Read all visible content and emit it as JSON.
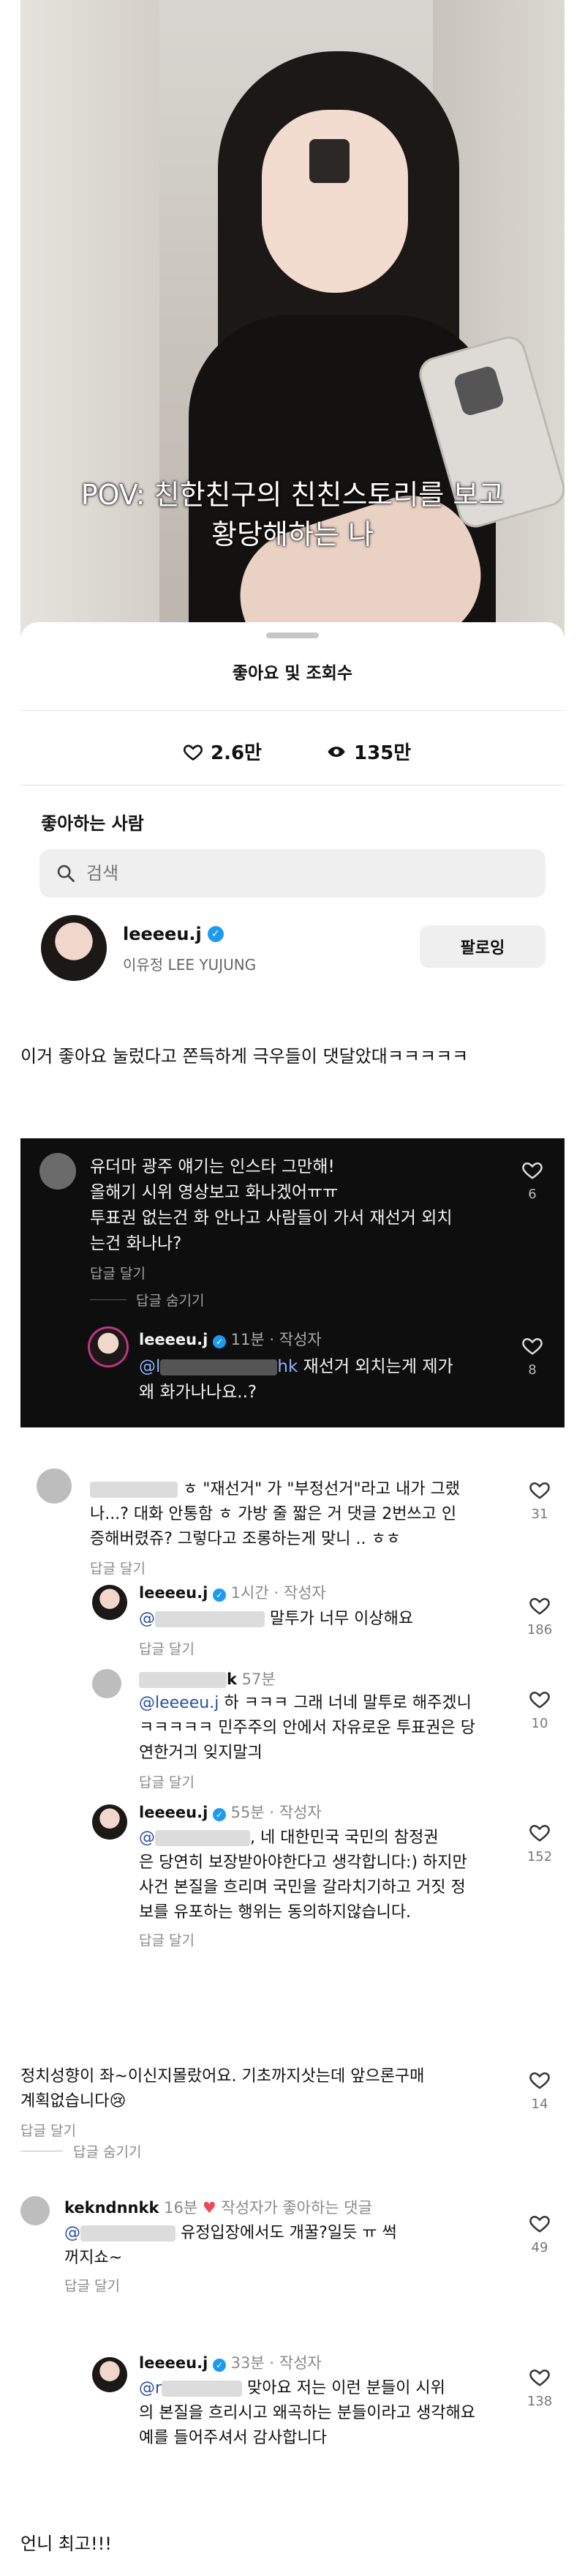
{
  "video": {
    "caption_line1": "POV: 친한친구의 친친스토리를 보고",
    "caption_line2": "황당해하는 나"
  },
  "likes_sheet": {
    "title": "좋아요 및 조회수",
    "likes_count": "2.6만",
    "views_count": "135만",
    "likers_title": "좋아하는 사람",
    "search_placeholder": "검색",
    "liker": {
      "username": "leeeeu.j",
      "real_name": "이유정 LEE YUJUNG",
      "follow_label": "팔로잉"
    }
  },
  "post_caption": "이거 좋아요 눌렀다고 쫀득하게 극우들이 댓달았대ㅋㅋㅋㅋㅋ",
  "dark_thread": {
    "comment": {
      "lines": [
        "유더마 광주 얘기는 인스타 그만해!",
        "올해기 시위 영상보고 화나겠어ㅠㅠ",
        "투표권 없는건 화 안나고 사람들이 가서 재선거 외치",
        "는건 화나나?"
      ],
      "reply_label": "답글 달기",
      "like_count": "6",
      "hide_replies": "답글 숨기기"
    },
    "reply": {
      "username": "leeeeu.j",
      "time": "11분",
      "author_tag": "작성자",
      "mention": "@l",
      "mention_tail": "hk",
      "line1_rest": "재선거 외치는게 제가",
      "line2": "왜 화가나나요..?",
      "like_count": "8"
    }
  },
  "thread2": {
    "c1": {
      "lines": [
        "ㅎ \"재선거\" 가 \"부정선거\"라고 내가 그랬",
        "나...? 대화 안통함 ㅎ 가방 줄 짧은 거 댓글 2번쓰고 인",
        "증해버렸쥬? 그렇다고 조롱하는게 맞니 .. ㅎㅎ"
      ],
      "reply_label": "답글 달기",
      "like_count": "31"
    },
    "r1": {
      "username": "leeeeu.j",
      "time": "1시간",
      "author_tag": "작성자",
      "mention": "@",
      "text": "말투가 너무 이상해요",
      "reply_label": "답글 달기",
      "like_count": "186"
    },
    "r2": {
      "username_tail": "k",
      "time": "57분",
      "mention": "@leeeeu.j",
      "lines_first": "하 ㅋㅋㅋ 그래 너네 말투로 해주겠니",
      "lines": [
        "ㅋㅋㅋㅋㅋ 민주주의 안에서 자유로운 투표권은 당",
        "연한거긔 잊지말긔"
      ],
      "reply_label": "답글 달기",
      "like_count": "10"
    },
    "r3": {
      "username": "leeeeu.j",
      "time": "55분",
      "author_tag": "작성자",
      "mention": "@",
      "first_rest": "네 대한민국 국민의 참정권",
      "lines": [
        "은 당연히 보장받아야한다고 생각합니다:) 하지만",
        "사건 본질을 흐리며 국민을 갈라치기하고 거짓 정",
        "보를 유포하는 행위는 동의하지않습니다."
      ],
      "reply_label": "답글 달기",
      "like_count": "152"
    }
  },
  "thread3": {
    "c1": {
      "lines": [
        "정치성향이 좌~이신지몰랐어요.  기초까지삿는데 앞으론구매",
        "계획없습니다😢"
      ],
      "reply_label": "답글 달기",
      "like_count": "14",
      "hide_replies": "답글 숨기기"
    }
  },
  "thread4": {
    "c1": {
      "username": "kekndnnkk",
      "time": "16분",
      "liked_tag": "작성자가 좋아하는 댓글",
      "mention": "@",
      "line1_rest": "유정입장에서도 개꿀?일듯 ㅠ 썩",
      "line2": "꺼지쇼~",
      "reply_label": "답글 달기",
      "like_count": "49"
    },
    "r1": {
      "username": "leeeeu.j",
      "time": "33분",
      "author_tag": "작성자",
      "mention": "@r",
      "line1_rest": "맞아요 저는 이런 분들이 시위",
      "lines": [
        "의 본질을 흐리시고 왜곡하는 분들이라고 생각해요",
        "예를 들어주셔서 감사합니다"
      ],
      "reply_label": "답글 달기",
      "like_count": "138"
    }
  },
  "final_text": "언니 최고!!!",
  "colors": {
    "verified": "#1d9bf0",
    "dark_bg": "#0e0e0e",
    "liked_heart": "#ed4956"
  }
}
